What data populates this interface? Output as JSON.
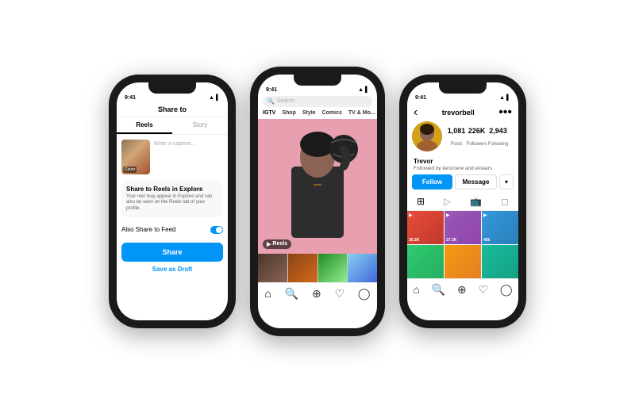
{
  "background": "#ffffff",
  "phones": [
    {
      "id": "share-phone",
      "status": {
        "time": "9:41",
        "signal": "●●●",
        "wifi": "▲",
        "battery": "▌"
      },
      "header": "Share to",
      "tabs": [
        "Reels",
        "Story"
      ],
      "active_tab": 0,
      "caption_placeholder": "Write a caption...",
      "cover_label": "Cover",
      "option_title": "Share to Reels in Explore",
      "option_desc": "Your reel may appear in Explore and can also be seen on the Reels tab of your profile.",
      "also_share": "Also Share to Feed",
      "share_button": "Share",
      "draft_button": "Save as Draft"
    },
    {
      "id": "feed-phone",
      "status": {
        "time": "9:41",
        "signal": "●●●",
        "wifi": "▲",
        "battery": "▌"
      },
      "search_placeholder": "Search",
      "categories": [
        "IGTV",
        "Shop",
        "Style",
        "Comics",
        "TV & Mo..."
      ],
      "reel_label": "Reels",
      "nav_items": [
        "home",
        "search",
        "plus",
        "heart",
        "person"
      ]
    },
    {
      "id": "profile-phone",
      "status": {
        "time": "9:41",
        "signal": "●●●",
        "wifi": "▲",
        "battery": "▌"
      },
      "username": "trevorbell",
      "stats": [
        {
          "num": "1,081",
          "label": "Posts"
        },
        {
          "num": "226K",
          "label": "Followers"
        },
        {
          "num": "2,943",
          "label": "Following"
        }
      ],
      "name": "Trevor",
      "followed_by": "Followed by kenzoere and eloears",
      "follow_btn": "Follow",
      "message_btn": "Message",
      "grid_counts": [
        "30.2K",
        "37.3K",
        "45k"
      ],
      "nav_items": [
        "home",
        "search",
        "plus",
        "heart",
        "person"
      ]
    }
  ]
}
